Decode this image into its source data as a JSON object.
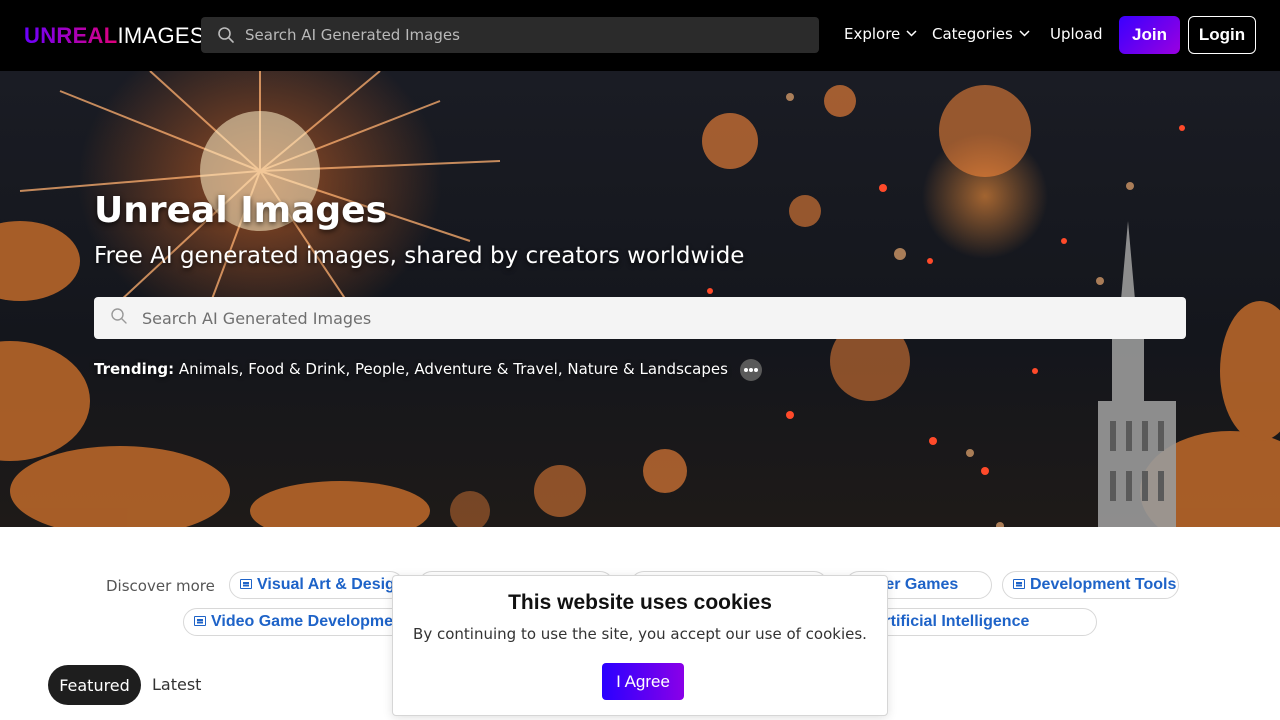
{
  "nav": {
    "logo_bold": "UNREAL",
    "logo_light": "IMAGES",
    "search_placeholder": "Search AI Generated Images",
    "explore": "Explore",
    "categories": "Categories",
    "upload": "Upload",
    "join": "Join",
    "login": "Login"
  },
  "hero": {
    "title": "Unreal Images",
    "subtitle": "Free AI generated images, shared by creators worldwide",
    "search_placeholder": "Search AI Generated Images",
    "trending_label": "Trending:",
    "trending": [
      "Animals",
      "Food & Drink",
      "People",
      "Adventure & Travel",
      "Nature & Landscapes"
    ]
  },
  "discover": {
    "label": "Discover more",
    "chips": [
      "Visual Art & Design",
      "Shooter Games",
      "Development Tools",
      "Video Game Development",
      "Machine Learning & Artificial Intelligence"
    ]
  },
  "tabs": {
    "featured": "Featured",
    "latest": "Latest"
  },
  "cookie": {
    "title": "This website uses cookies",
    "text": "By continuing to use the site, you accept our use of cookies.",
    "button": "I Agree"
  },
  "colors": {
    "accent": "#5b00ff",
    "link": "#1e63c8",
    "navbar": "#000000"
  }
}
